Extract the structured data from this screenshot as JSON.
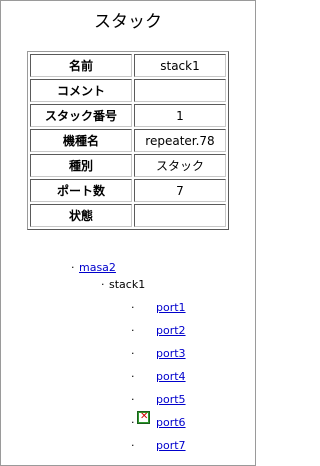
{
  "page": {
    "title": "スタック"
  },
  "info_table": [
    {
      "label": "名前",
      "value": "stack1"
    },
    {
      "label": "コメント",
      "value": ""
    },
    {
      "label": "スタック番号",
      "value": "1"
    },
    {
      "label": "機種名",
      "value": "repeater.78"
    },
    {
      "label": "種別",
      "value": "スタック"
    },
    {
      "label": "ポート数",
      "value": "7"
    },
    {
      "label": "状態",
      "value": ""
    }
  ],
  "tree": {
    "root": {
      "label": "masa2"
    },
    "stack": {
      "label": "stack1"
    },
    "ports": [
      {
        "label": "port1",
        "status_icon": ""
      },
      {
        "label": "port2",
        "status_icon": ""
      },
      {
        "label": "port3",
        "status_icon": ""
      },
      {
        "label": "port4",
        "status_icon": ""
      },
      {
        "label": "port5",
        "status_icon": ""
      },
      {
        "label": "port6",
        "status_icon": "port-status-warning-icon"
      },
      {
        "label": "port7",
        "status_icon": ""
      }
    ]
  },
  "colors": {
    "link": "#0000cc",
    "status_icon": "#2e9a2e",
    "status_mark": "#d00000"
  }
}
